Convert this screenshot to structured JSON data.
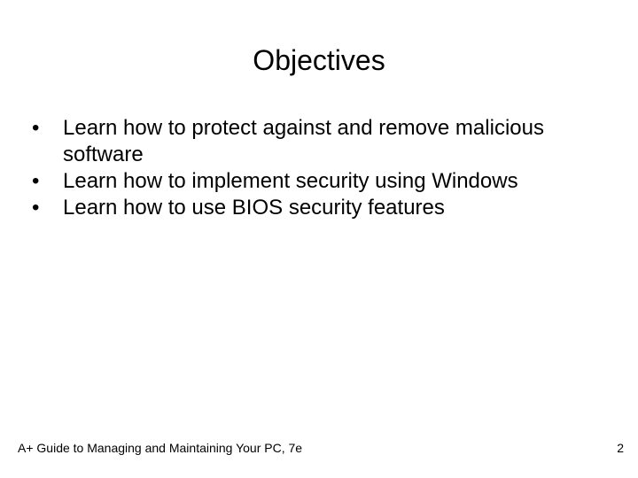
{
  "slide": {
    "title": "Objectives",
    "bullet_glyph": "•",
    "bullets": [
      "Learn how to protect against and remove malicious software",
      "Learn how to implement security using Windows",
      "Learn how to use BIOS security features"
    ]
  },
  "footer": {
    "text": "A+ Guide to Managing and Maintaining Your PC, 7e",
    "page_number": "2"
  }
}
